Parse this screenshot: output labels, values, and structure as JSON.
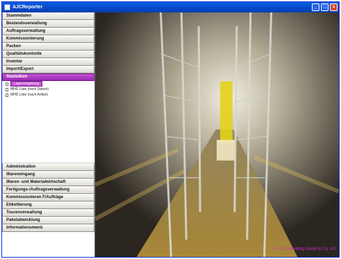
{
  "window": {
    "title": "AJCReporter"
  },
  "sidebar": {
    "top_items": [
      {
        "label": "Stammdaten"
      },
      {
        "label": "Bestandsverwaltung"
      },
      {
        "label": "Auftragsverwaltung"
      },
      {
        "label": "Kommissionierung"
      },
      {
        "label": "Packen"
      },
      {
        "label": "Qualitätskontrolle"
      },
      {
        "label": "Inventar"
      },
      {
        "label": "Import/Export"
      },
      {
        "label": "Statistiken"
      }
    ],
    "tree": [
      {
        "label": "Lagerumgebung",
        "selected": true
      },
      {
        "label": "MHD Liste (nach Datum)",
        "selected": false
      },
      {
        "label": "MHD Liste (nach Artikel)",
        "selected": false
      }
    ],
    "bottom_items": [
      {
        "label": "Administration"
      },
      {
        "label": "Wareneingang"
      },
      {
        "label": "Waren- und Materialwirtschaft"
      },
      {
        "label": "Fertigungs-/Auftragsverwaltung"
      },
      {
        "label": "Kommissionieren F/Aufträge"
      },
      {
        "label": "Etikettierung"
      },
      {
        "label": "Tourenverwaltung"
      },
      {
        "label": "Paketabwicklung"
      },
      {
        "label": "Informationsmenü"
      }
    ]
  },
  "main": {
    "watermark": "A.JC Consulting GmbH & Co. KG"
  },
  "colors": {
    "accent": "#b03cc8",
    "titlebar": "#0548c8"
  }
}
